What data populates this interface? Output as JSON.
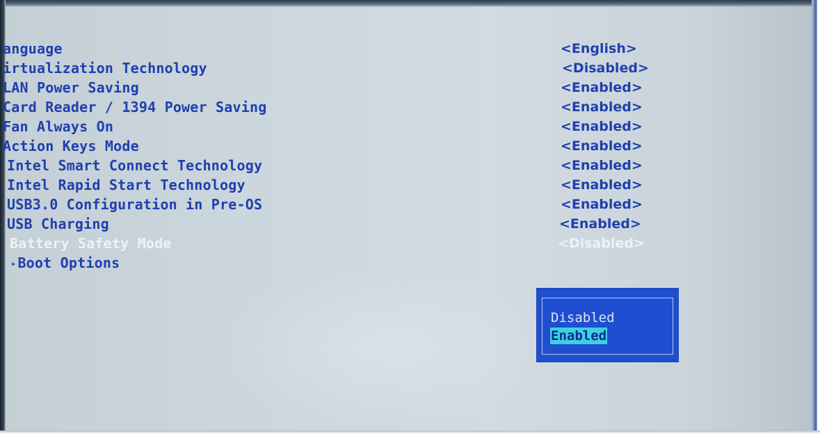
{
  "settings": [
    {
      "label": "anguage",
      "value": "<English>",
      "selected": false
    },
    {
      "label": "irtualization Technology",
      "value": "<Disabled>",
      "selected": false
    },
    {
      "label": "LAN Power Saving",
      "value": "<Enabled>",
      "selected": false
    },
    {
      "label": "Card Reader / 1394 Power Saving",
      "value": "<Enabled>",
      "selected": false
    },
    {
      "label": "Fan Always On",
      "value": "<Enabled>",
      "selected": false
    },
    {
      "label": "Action Keys Mode",
      "value": "<Enabled>",
      "selected": false
    },
    {
      "label": "Intel Smart Connect Technology",
      "value": "<Enabled>",
      "selected": false
    },
    {
      "label": "Intel Rapid Start Technology",
      "value": "<Enabled>",
      "selected": false
    },
    {
      "label": "USB3.0 Configuration in Pre-OS",
      "value": "<Enabled>",
      "selected": false
    },
    {
      "label": "USB Charging",
      "value": "<Enabled>",
      "selected": false
    },
    {
      "label": "Battery Safety Mode",
      "value": "<Disabled>",
      "selected": true
    }
  ],
  "submenu": {
    "arrow": "▸",
    "label": "Boot Options"
  },
  "popup": {
    "options": [
      "Disabled",
      "Enabled"
    ],
    "highlighted": "Enabled"
  },
  "colors": {
    "text": "#1f3fae",
    "selected_text": "#eef2f6",
    "popup_background": "#1f4fd0",
    "popup_highlight": "#3fd0e0"
  },
  "icons": {
    "submenu": "triangle-right-icon"
  }
}
